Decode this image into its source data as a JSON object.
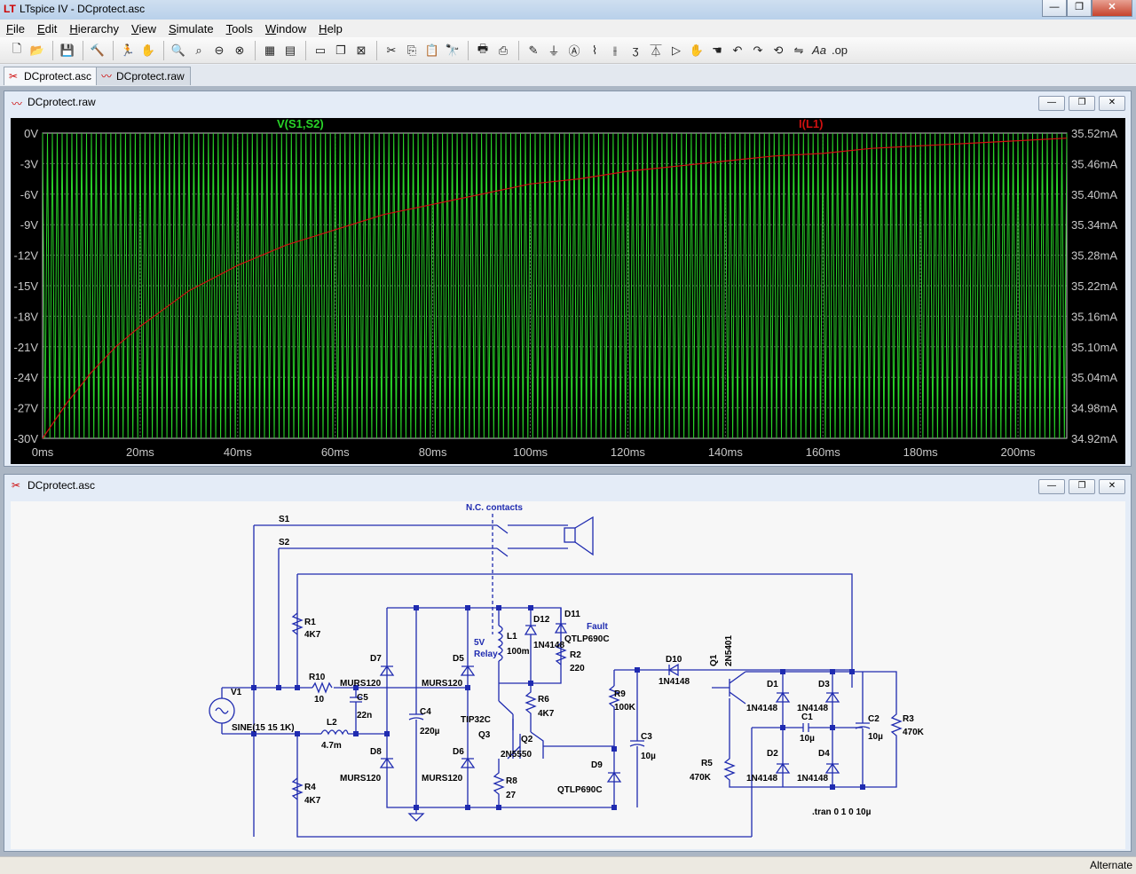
{
  "app": {
    "title": "LTspice IV - DCprotect.asc",
    "logo": "LT"
  },
  "window_buttons": {
    "minimize": "—",
    "restore": "❐",
    "close": "✕"
  },
  "menu": [
    "File",
    "Edit",
    "Hierarchy",
    "View",
    "Simulate",
    "Tools",
    "Window",
    "Help"
  ],
  "toolbar_icons": [
    "new-schematic-icon",
    "open-icon",
    "save-icon",
    "control-panel-icon",
    "run-icon",
    "halt-icon",
    "zoom-in-icon",
    "pan-icon",
    "zoom-out-icon",
    "zoom-fit-icon",
    "autorange-icon",
    "plot-settings-icon",
    "tile-horizontal-icon",
    "cascade-icon",
    "close-window-icon",
    "cut-icon",
    "copy-icon",
    "paste-icon",
    "find-icon",
    "print-preview-icon",
    "print-icon",
    "draw-wire-icon",
    "ground-icon",
    "label-net-icon",
    "resistor-icon",
    "capacitor-icon",
    "inductor-icon",
    "diode-icon",
    "component-icon",
    "move-icon",
    "drag-icon",
    "undo-icon",
    "redo-icon",
    "rotate-icon",
    "mirror-icon",
    "text-icon",
    "spice-directive-icon"
  ],
  "tabs": [
    {
      "label": "DCprotect.asc"
    },
    {
      "label": "DCprotect.raw"
    }
  ],
  "plot_window": {
    "title": "DCprotect.raw",
    "colors": {
      "background": "#000000",
      "trace1": "#29d629",
      "trace2": "#d01010",
      "grid": "#5a5a5a",
      "axis_text": "#c8c8c8"
    }
  },
  "chart_data": {
    "type": "line",
    "title": "",
    "xlabel": "",
    "x_ticks": [
      "0ms",
      "20ms",
      "40ms",
      "60ms",
      "80ms",
      "100ms",
      "120ms",
      "140ms",
      "160ms",
      "180ms",
      "200ms"
    ],
    "xlim": [
      0,
      210
    ],
    "y_left_ticks": [
      "0V",
      "-3V",
      "-6V",
      "-9V",
      "-12V",
      "-15V",
      "-18V",
      "-21V",
      "-24V",
      "-27V",
      "-30V"
    ],
    "ylim_left": [
      -30,
      0
    ],
    "y_right_ticks": [
      "35.52mA",
      "35.46mA",
      "35.40mA",
      "35.34mA",
      "35.28mA",
      "35.22mA",
      "35.16mA",
      "35.10mA",
      "35.04mA",
      "34.98mA",
      "34.92mA"
    ],
    "ylim_right": [
      34.92,
      35.52
    ],
    "grid": true,
    "series": [
      {
        "name": "V(S1,S2)",
        "axis": "left",
        "frequency_hz": 1000,
        "min": -30,
        "max": 0,
        "x": [
          0,
          20,
          40,
          60,
          80,
          100,
          120,
          140,
          160,
          180,
          200,
          210
        ],
        "y_envelope": [
          0,
          0,
          0,
          0,
          0,
          0,
          0,
          0,
          0,
          0,
          0,
          0
        ]
      },
      {
        "name": "I(L1)",
        "axis": "right",
        "x": [
          0,
          5,
          10,
          15,
          20,
          30,
          40,
          50,
          60,
          70,
          80,
          90,
          100,
          110,
          120,
          130,
          140,
          150,
          160,
          170,
          180,
          190,
          200,
          210
        ],
        "y": [
          34.92,
          34.99,
          35.05,
          35.1,
          35.14,
          35.21,
          35.26,
          35.3,
          35.33,
          35.36,
          35.38,
          35.4,
          35.42,
          35.43,
          35.445,
          35.455,
          35.465,
          35.475,
          35.48,
          35.49,
          35.495,
          35.5,
          35.505,
          35.51
        ]
      }
    ]
  },
  "schematic_window": {
    "title": "DCprotect.asc",
    "labels": {
      "s1": "S1",
      "s2": "S2",
      "nc": "N.C. contacts",
      "r1": "R1",
      "r1v": "4K7",
      "r10": "R10",
      "r10v": "10",
      "c5": "C5",
      "c5v": "22n",
      "v1": "V1",
      "v1v": "SINE(15 15 1K)",
      "l2": "L2",
      "l2v": "4.7m",
      "r4": "R4",
      "r4v": "4K7",
      "d7": "D7",
      "d7v": "MURS120",
      "d8": "D8",
      "d8v": "MURS120",
      "c4": "C4",
      "c4v": "220µ",
      "d5": "D5",
      "d5v": "MURS120",
      "d6": "D6",
      "d6v": "MURS120",
      "relay1": "5V",
      "relay2": "Relay",
      "l1": "L1",
      "l1v": "100m",
      "d12": "D12",
      "d12v": "1N4148",
      "d11": "D11",
      "fault": "Fault",
      "d11v": "QTLP690C",
      "r2": "R2",
      "r2v": "220",
      "r6": "R6",
      "r6v": "4K7",
      "q3": "Q3",
      "q3v": "TIP32C",
      "q2": "Q2",
      "q2v": "2N5550",
      "r8": "R8",
      "r8v": "27",
      "r9": "R9",
      "r9v": "100K",
      "c3": "C3",
      "c3v": "10µ",
      "d9": "D9",
      "d9v": "QTLP690C",
      "d10": "D10",
      "d10v": "1N4148",
      "q1": "Q1",
      "q1v": "2N5401",
      "r5": "R5",
      "r5v": "470K",
      "d1": "D1",
      "d1v": "1N4148",
      "d3": "D3",
      "d3v": "1N4148",
      "c1": "C1",
      "c1v": "10µ",
      "d2": "D2",
      "d2v": "1N4148",
      "d4": "D4",
      "d4v": "1N4148",
      "c2": "C2",
      "c2v": "10µ",
      "r3": "R3",
      "r3v": "470K",
      "tran": ".tran 0 1 0 10µ"
    }
  },
  "status": {
    "text": "Alternate"
  }
}
